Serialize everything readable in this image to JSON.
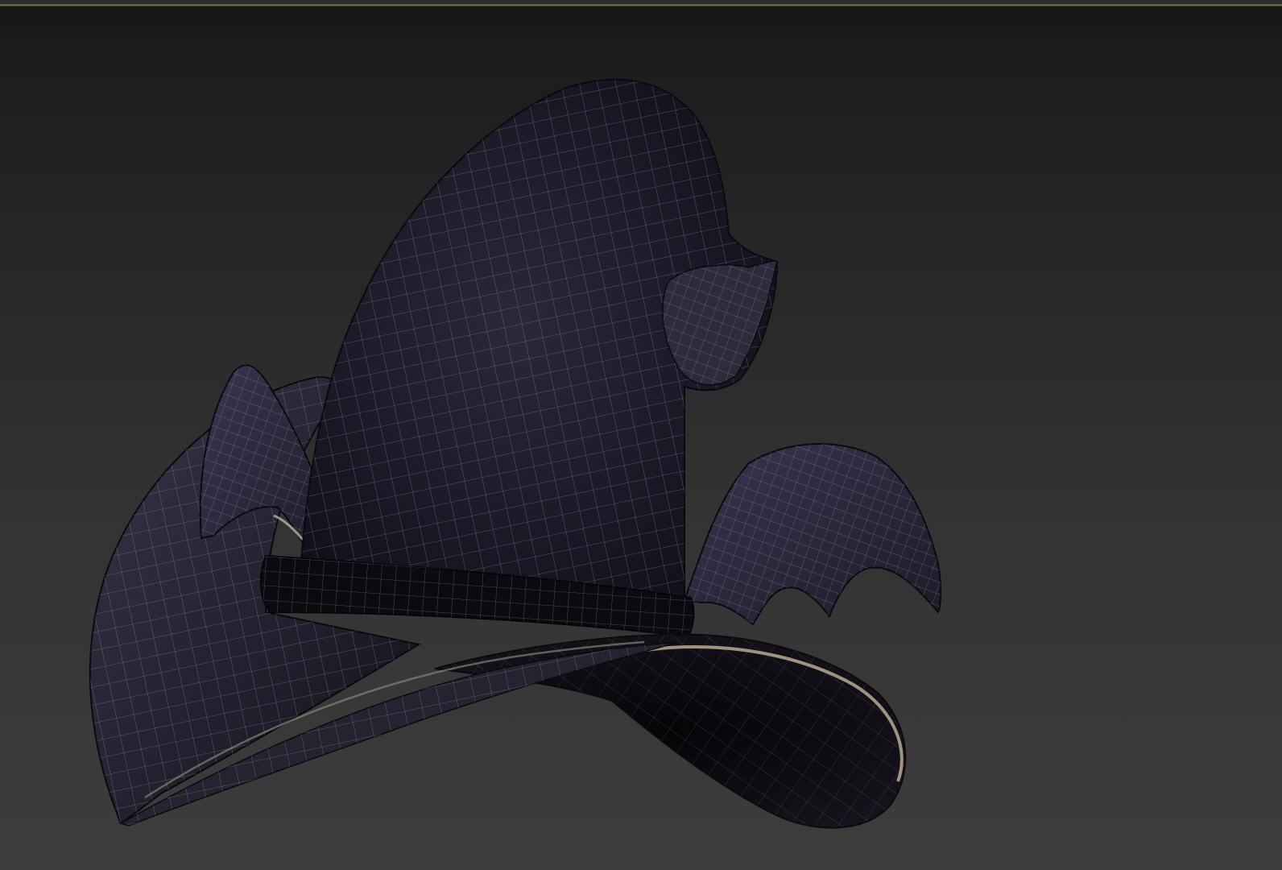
{
  "viewport": {
    "background_top": "#141414",
    "background_bottom": "#3d3d3d",
    "active_border_color": "#8a7f5a"
  },
  "model": {
    "shading_mode": "wireframe-on-shaded",
    "surface_color": "#1e1a28",
    "wire_color": "#a9a3c2",
    "band_color": "#0c0a10",
    "brim_edge_color": "#b9aa90"
  }
}
